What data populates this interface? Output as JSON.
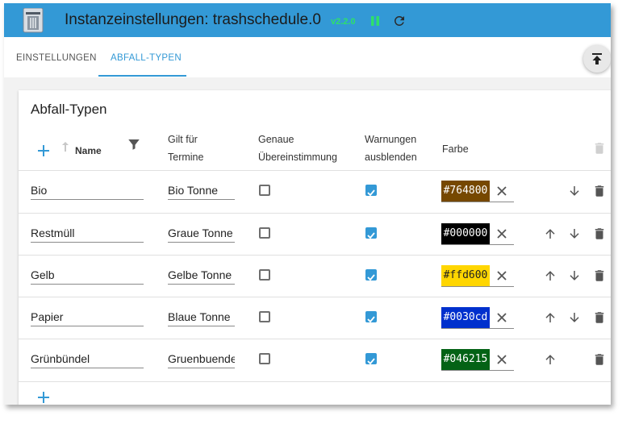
{
  "window": {
    "title": "Instanzeinstellungen: trashschedule.0",
    "version": "v2.2.0",
    "icons": [
      "app-trash-icon",
      "pause-icon",
      "reload-icon"
    ]
  },
  "tabs": [
    {
      "label": "EINSTELLUNGEN",
      "active": false
    },
    {
      "label": "ABFALL-TYPEN",
      "active": true
    }
  ],
  "card": {
    "title": "Abfall-Typen",
    "headers": {
      "name": "Name",
      "gilt_line1": "Gilt für",
      "gilt_line2": "Termine",
      "genau_line1": "Genaue",
      "genau_line2": "Übereinstimmung",
      "warn_line1": "Warnungen",
      "warn_line2": "ausblenden",
      "farbe": "Farbe"
    },
    "rows": [
      {
        "name": "Bio",
        "termin": "Bio Tonne",
        "exact": false,
        "hide_warnings": true,
        "color": "#764800",
        "color_label": "#764800",
        "up": false,
        "down": true
      },
      {
        "name": "Restmüll",
        "termin": "Graue Tonne",
        "exact": false,
        "hide_warnings": true,
        "color": "#000000",
        "color_label": "#000000",
        "up": true,
        "down": true
      },
      {
        "name": "Gelb",
        "termin": "Gelbe Tonne",
        "exact": false,
        "hide_warnings": true,
        "color": "#ffd600",
        "color_label": "#ffd600",
        "up": true,
        "down": true
      },
      {
        "name": "Papier",
        "termin": "Blaue Tonne",
        "exact": false,
        "hide_warnings": true,
        "color": "#0030cd",
        "color_label": "#0030cd",
        "up": true,
        "down": true
      },
      {
        "name": "Grünbündel",
        "termin": "Gruenbuende",
        "exact": false,
        "hide_warnings": true,
        "color": "#046215",
        "color_label": "#046215",
        "up": true,
        "down": false
      }
    ]
  },
  "colors": {
    "accent": "#3399d6",
    "version_green": "#2ee06a",
    "icon_grey": "#6e6e6e"
  }
}
